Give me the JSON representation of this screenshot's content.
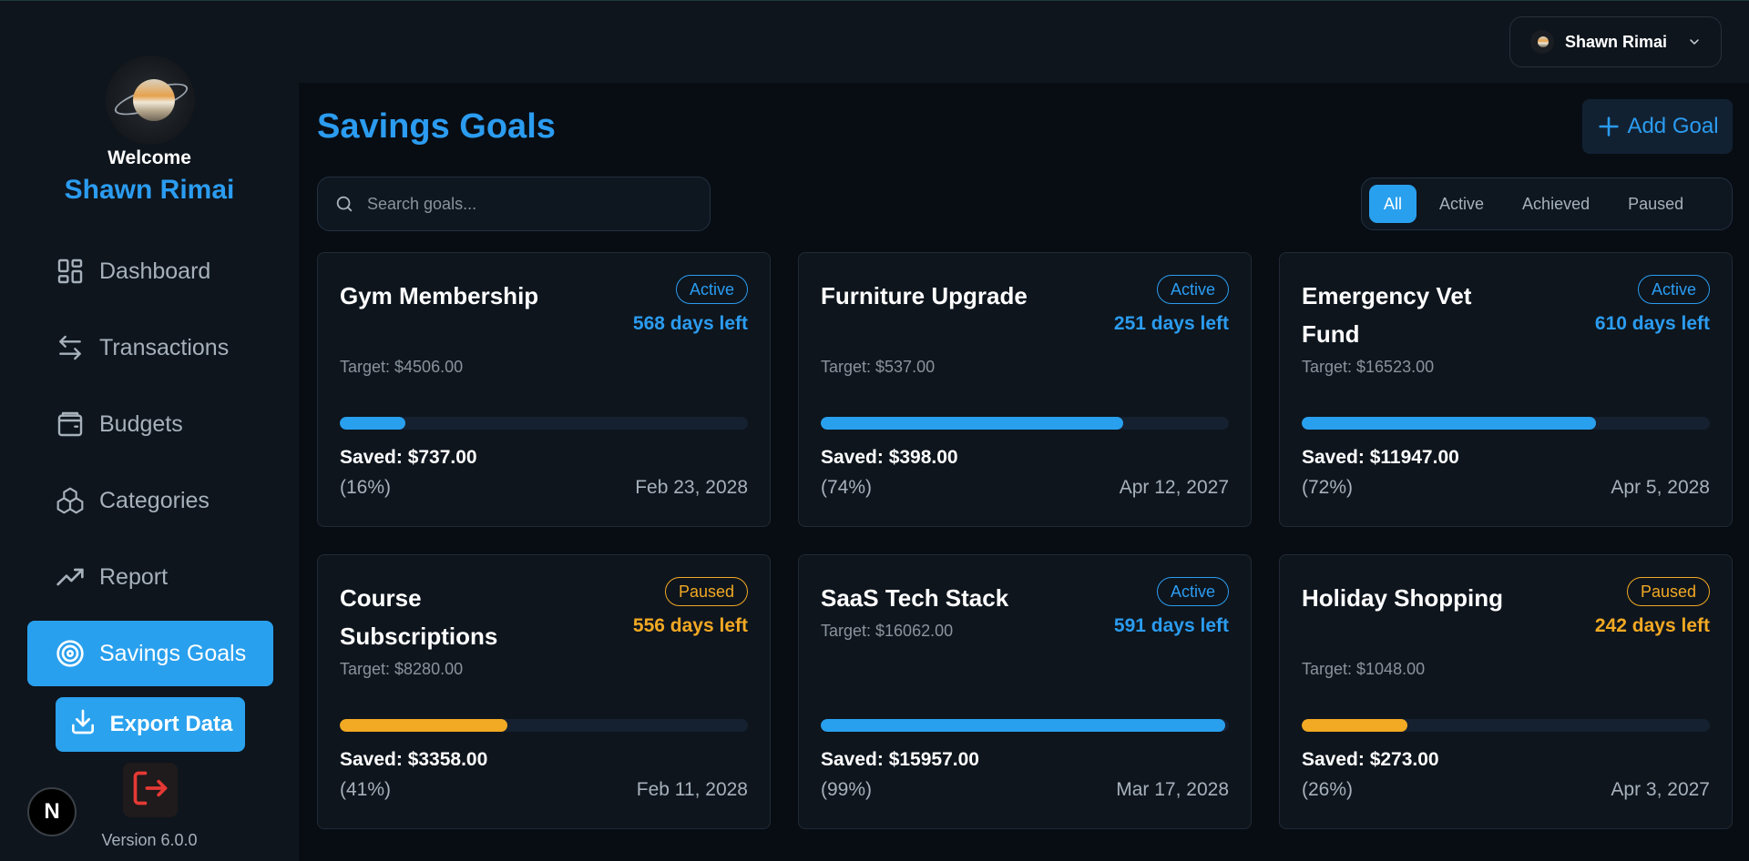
{
  "sidebar": {
    "welcome": "Welcome",
    "username": "Shawn Rimai",
    "items": [
      {
        "label": "Dashboard",
        "icon": "dashboard-icon"
      },
      {
        "label": "Transactions",
        "icon": "arrows-swap-icon"
      },
      {
        "label": "Budgets",
        "icon": "wallet-icon"
      },
      {
        "label": "Categories",
        "icon": "boxes-icon"
      },
      {
        "label": "Report",
        "icon": "trending-up-icon"
      },
      {
        "label": "Savings Goals",
        "icon": "target-icon",
        "active": true
      }
    ],
    "export_label": "Export Data",
    "version": "Version 6.0.0",
    "badge_letter": "N"
  },
  "header": {
    "user_name": "Shawn Rimai"
  },
  "main": {
    "title": "Savings Goals",
    "add_goal_label": "Add Goal",
    "search_placeholder": "Search goals...",
    "filters": [
      "All",
      "Active",
      "Achieved",
      "Paused"
    ],
    "active_filter": "All",
    "goals": [
      {
        "title": "Gym Membership",
        "status": "Active",
        "days_left": "568 days left",
        "target": "Target: $4506.00",
        "saved": "Saved: $737.00",
        "percent": "(16%)",
        "progress": 0.16,
        "date": "Feb 23, 2028"
      },
      {
        "title": "Furniture Upgrade",
        "status": "Active",
        "days_left": "251 days left",
        "target": "Target: $537.00",
        "saved": "Saved: $398.00",
        "percent": "(74%)",
        "progress": 0.74,
        "date": "Apr 12, 2027"
      },
      {
        "title": "Emergency Vet Fund",
        "status": "Active",
        "days_left": "610 days left",
        "target": "Target: $16523.00",
        "saved": "Saved: $11947.00",
        "percent": "(72%)",
        "progress": 0.72,
        "date": "Apr 5, 2028"
      },
      {
        "title": "Course Subscriptions",
        "status": "Paused",
        "days_left": "556 days left",
        "target": "Target: $8280.00",
        "saved": "Saved: $3358.00",
        "percent": "(41%)",
        "progress": 0.41,
        "date": "Feb 11, 2028"
      },
      {
        "title": "SaaS Tech Stack",
        "status": "Active",
        "days_left": "591 days left",
        "target": "Target: $16062.00",
        "saved": "Saved: $15957.00",
        "percent": "(99%)",
        "progress": 0.99,
        "date": "Mar 17, 2028"
      },
      {
        "title": "Holiday Shopping",
        "status": "Paused",
        "days_left": "242 days left",
        "target": "Target: $1048.00",
        "saved": "Saved: $273.00",
        "percent": "(26%)",
        "progress": 0.26,
        "date": "Apr 3, 2027"
      }
    ]
  },
  "colors": {
    "accent": "#2b9cf0",
    "paused": "#f2a923",
    "background": "#080d14",
    "panel": "#0e151d"
  }
}
